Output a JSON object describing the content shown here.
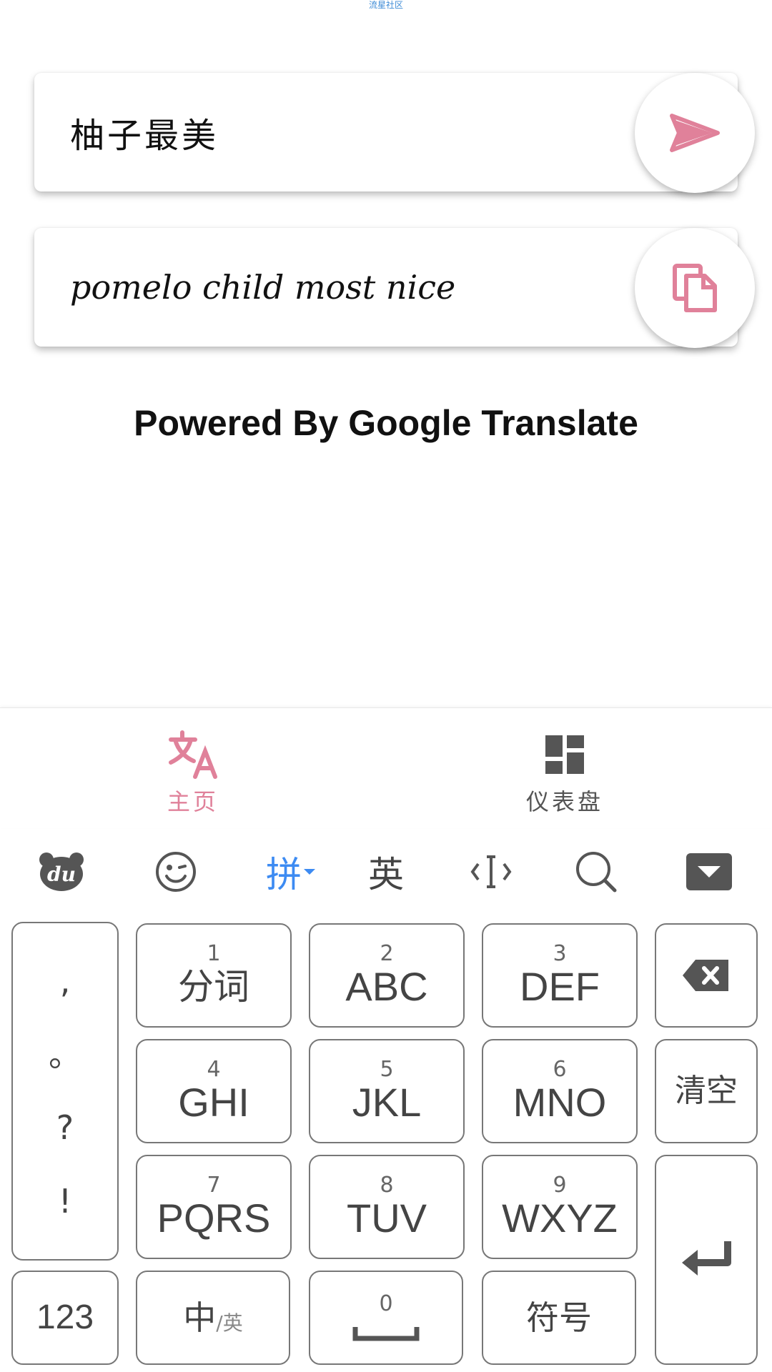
{
  "status_hint": "流星社区",
  "input_card": {
    "text": "柚子最美"
  },
  "output_card": {
    "text": "pomelo child most nice"
  },
  "powered_by": "Powered By Google Translate",
  "bottom_nav": {
    "home_label": "主页",
    "dashboard_label": "仪表盘"
  },
  "keyboard": {
    "toolbar": {
      "pinyin": "拼",
      "english": "英"
    },
    "punct": [
      ",",
      "。",
      "?",
      "!"
    ],
    "keys": [
      {
        "num": "1",
        "label": "分词"
      },
      {
        "num": "2",
        "label": "ABC"
      },
      {
        "num": "3",
        "label": "DEF"
      },
      {
        "num": "4",
        "label": "GHI"
      },
      {
        "num": "5",
        "label": "JKL"
      },
      {
        "num": "6",
        "label": "MNO"
      },
      {
        "num": "7",
        "label": "PQRS"
      },
      {
        "num": "8",
        "label": "TUV"
      },
      {
        "num": "9",
        "label": "WXYZ"
      }
    ],
    "clear_label": "清空",
    "num_switch_label": "123",
    "lang_switch_main": "中",
    "lang_switch_sub": "/英",
    "space_num": "0",
    "symbol_label": "符号"
  },
  "colors": {
    "accent_pink": "#e0819a",
    "pinyin_blue": "#3d8bf2",
    "icon_gray": "#555555"
  }
}
